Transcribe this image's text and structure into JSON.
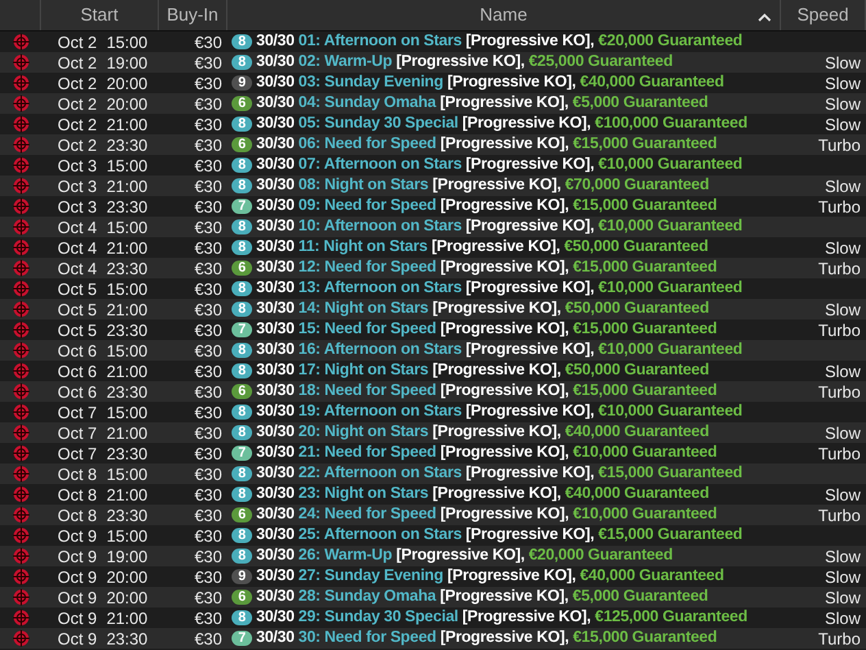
{
  "columns": [
    {
      "label": "Start"
    },
    {
      "label": "Buy-In"
    },
    {
      "label": "Name",
      "sorted": true
    },
    {
      "label": "Speed"
    }
  ],
  "rows": [
    {
      "date": "Oct 2",
      "time": "15:00",
      "buyin": "€30",
      "badge": "8",
      "color": "#4aaebb",
      "entries": "30/30",
      "title": "01: Afternoon on Stars",
      "format": "[Progressive KO],",
      "guarantee": "€20,000 Guaranteed"
    },
    {
      "date": "Oct 2",
      "time": "19:00",
      "buyin": "€30",
      "badge": "8",
      "color": "#4aaebb",
      "entries": "30/30",
      "title": "02: Warm-Up",
      "format": "[Progressive KO],",
      "guarantee": "€25,000 Guaranteed",
      "speed": "Slow"
    },
    {
      "date": "Oct 2",
      "time": "20:00",
      "buyin": "€30",
      "badge": "9",
      "color": "#505050",
      "entries": "30/30",
      "title": "03: Sunday Evening",
      "format": "[Progressive KO],",
      "guarantee": "€40,000 Guaranteed",
      "speed": "Slow"
    },
    {
      "date": "Oct 2",
      "time": "20:00",
      "buyin": "€30",
      "badge": "6",
      "color": "#5b9a3c",
      "entries": "30/30",
      "title": "04: Sunday Omaha",
      "format": "[Progressive KO],",
      "guarantee": "€5,000 Guaranteed",
      "speed": "Slow"
    },
    {
      "date": "Oct 2",
      "time": "21:00",
      "buyin": "€30",
      "badge": "8",
      "color": "#4aaebb",
      "entries": "30/30",
      "title": "05: Sunday 30 Special",
      "format": "[Progressive KO],",
      "guarantee": "€100,000 Guaranteed",
      "speed": "Slow"
    },
    {
      "date": "Oct 2",
      "time": "23:30",
      "buyin": "€30",
      "badge": "6",
      "color": "#5b9a3c",
      "entries": "30/30",
      "title": "06: Need for Speed",
      "format": "[Progressive KO],",
      "guarantee": "€15,000 Guaranteed",
      "speed": "Turbo"
    },
    {
      "date": "Oct 3",
      "time": "15:00",
      "buyin": "€30",
      "badge": "8",
      "color": "#4aaebb",
      "entries": "30/30",
      "title": "07: Afternoon on Stars",
      "format": "[Progressive KO],",
      "guarantee": "€10,000 Guaranteed"
    },
    {
      "date": "Oct 3",
      "time": "21:00",
      "buyin": "€30",
      "badge": "8",
      "color": "#4aaebb",
      "entries": "30/30",
      "title": "08: Night on Stars",
      "format": "[Progressive KO],",
      "guarantee": "€70,000 Guaranteed",
      "speed": "Slow"
    },
    {
      "date": "Oct 3",
      "time": "23:30",
      "buyin": "€30",
      "badge": "7",
      "color": "#6cbf9c",
      "entries": "30/30",
      "title": "09: Need for Speed",
      "format": "[Progressive KO],",
      "guarantee": "€15,000 Guaranteed",
      "speed": "Turbo"
    },
    {
      "date": "Oct 4",
      "time": "15:00",
      "buyin": "€30",
      "badge": "8",
      "color": "#4aaebb",
      "entries": "30/30",
      "title": "10: Afternoon on Stars",
      "format": "[Progressive KO],",
      "guarantee": "€10,000 Guaranteed"
    },
    {
      "date": "Oct 4",
      "time": "21:00",
      "buyin": "€30",
      "badge": "8",
      "color": "#4aaebb",
      "entries": "30/30",
      "title": "11: Night on Stars",
      "format": "[Progressive KO],",
      "guarantee": "€50,000 Guaranteed",
      "speed": "Slow"
    },
    {
      "date": "Oct 4",
      "time": "23:30",
      "buyin": "€30",
      "badge": "6",
      "color": "#5b9a3c",
      "entries": "30/30",
      "title": "12: Need for Speed",
      "format": "[Progressive KO],",
      "guarantee": "€15,000 Guaranteed",
      "speed": "Turbo"
    },
    {
      "date": "Oct 5",
      "time": "15:00",
      "buyin": "€30",
      "badge": "8",
      "color": "#4aaebb",
      "entries": "30/30",
      "title": "13: Afternoon on Stars",
      "format": "[Progressive KO],",
      "guarantee": "€10,000 Guaranteed"
    },
    {
      "date": "Oct 5",
      "time": "21:00",
      "buyin": "€30",
      "badge": "8",
      "color": "#4aaebb",
      "entries": "30/30",
      "title": "14: Night on Stars",
      "format": "[Progressive KO],",
      "guarantee": "€50,000 Guaranteed",
      "speed": "Slow"
    },
    {
      "date": "Oct 5",
      "time": "23:30",
      "buyin": "€30",
      "badge": "7",
      "color": "#6cbf9c",
      "entries": "30/30",
      "title": "15: Need for Speed",
      "format": "[Progressive KO],",
      "guarantee": "€15,000 Guaranteed",
      "speed": "Turbo"
    },
    {
      "date": "Oct 6",
      "time": "15:00",
      "buyin": "€30",
      "badge": "8",
      "color": "#4aaebb",
      "entries": "30/30",
      "title": "16: Afternoon on Stars",
      "format": "[Progressive KO],",
      "guarantee": "€10,000 Guaranteed"
    },
    {
      "date": "Oct 6",
      "time": "21:00",
      "buyin": "€30",
      "badge": "8",
      "color": "#4aaebb",
      "entries": "30/30",
      "title": "17: Night on Stars",
      "format": "[Progressive KO],",
      "guarantee": "€50,000 Guaranteed",
      "speed": "Slow"
    },
    {
      "date": "Oct 6",
      "time": "23:30",
      "buyin": "€30",
      "badge": "6",
      "color": "#5b9a3c",
      "entries": "30/30",
      "title": "18: Need for Speed",
      "format": "[Progressive KO],",
      "guarantee": "€15,000 Guaranteed",
      "speed": "Turbo"
    },
    {
      "date": "Oct 7",
      "time": "15:00",
      "buyin": "€30",
      "badge": "8",
      "color": "#4aaebb",
      "entries": "30/30",
      "title": "19: Afternoon on Stars",
      "format": "[Progressive KO],",
      "guarantee": "€10,000 Guaranteed"
    },
    {
      "date": "Oct 7",
      "time": "21:00",
      "buyin": "€30",
      "badge": "8",
      "color": "#4aaebb",
      "entries": "30/30",
      "title": "20: Night on Stars",
      "format": "[Progressive KO],",
      "guarantee": "€40,000 Guaranteed",
      "speed": "Slow"
    },
    {
      "date": "Oct 7",
      "time": "23:30",
      "buyin": "€30",
      "badge": "7",
      "color": "#6cbf9c",
      "entries": "30/30",
      "title": "21: Need for Speed",
      "format": "[Progressive KO],",
      "guarantee": "€10,000 Guaranteed",
      "speed": "Turbo"
    },
    {
      "date": "Oct 8",
      "time": "15:00",
      "buyin": "€30",
      "badge": "8",
      "color": "#4aaebb",
      "entries": "30/30",
      "title": "22: Afternoon on Stars",
      "format": "[Progressive KO],",
      "guarantee": "€15,000 Guaranteed"
    },
    {
      "date": "Oct 8",
      "time": "21:00",
      "buyin": "€30",
      "badge": "8",
      "color": "#4aaebb",
      "entries": "30/30",
      "title": "23: Night on Stars",
      "format": "[Progressive KO],",
      "guarantee": "€40,000 Guaranteed",
      "speed": "Slow"
    },
    {
      "date": "Oct 8",
      "time": "23:30",
      "buyin": "€30",
      "badge": "6",
      "color": "#5b9a3c",
      "entries": "30/30",
      "title": "24: Need for Speed",
      "format": "[Progressive KO],",
      "guarantee": "€10,000 Guaranteed",
      "speed": "Turbo"
    },
    {
      "date": "Oct 9",
      "time": "15:00",
      "buyin": "€30",
      "badge": "8",
      "color": "#4aaebb",
      "entries": "30/30",
      "title": "25: Afternoon on Stars",
      "format": "[Progressive KO],",
      "guarantee": "€15,000 Guaranteed"
    },
    {
      "date": "Oct 9",
      "time": "19:00",
      "buyin": "€30",
      "badge": "8",
      "color": "#4aaebb",
      "entries": "30/30",
      "title": "26: Warm-Up",
      "format": "[Progressive KO],",
      "guarantee": "€20,000 Guaranteed",
      "speed": "Slow"
    },
    {
      "date": "Oct 9",
      "time": "20:00",
      "buyin": "€30",
      "badge": "9",
      "color": "#505050",
      "entries": "30/30",
      "title": "27: Sunday Evening",
      "format": "[Progressive KO],",
      "guarantee": "€40,000 Guaranteed",
      "speed": "Slow"
    },
    {
      "date": "Oct 9",
      "time": "20:00",
      "buyin": "€30",
      "badge": "6",
      "color": "#5b9a3c",
      "entries": "30/30",
      "title": "28: Sunday Omaha",
      "format": "[Progressive KO],",
      "guarantee": "€5,000 Guaranteed",
      "speed": "Slow"
    },
    {
      "date": "Oct 9",
      "time": "21:00",
      "buyin": "€30",
      "badge": "8",
      "color": "#4aaebb",
      "entries": "30/30",
      "title": "29: Sunday 30 Special",
      "format": "[Progressive KO],",
      "guarantee": "€125,000 Guaranteed",
      "speed": "Slow"
    },
    {
      "date": "Oct 9",
      "time": "23:30",
      "buyin": "€30",
      "badge": "7",
      "color": "#6cbf9c",
      "entries": "30/30",
      "title": "30: Need for Speed",
      "format": "[Progressive KO],",
      "guarantee": "€15,000 Guaranteed",
      "speed": "Turbo"
    }
  ]
}
